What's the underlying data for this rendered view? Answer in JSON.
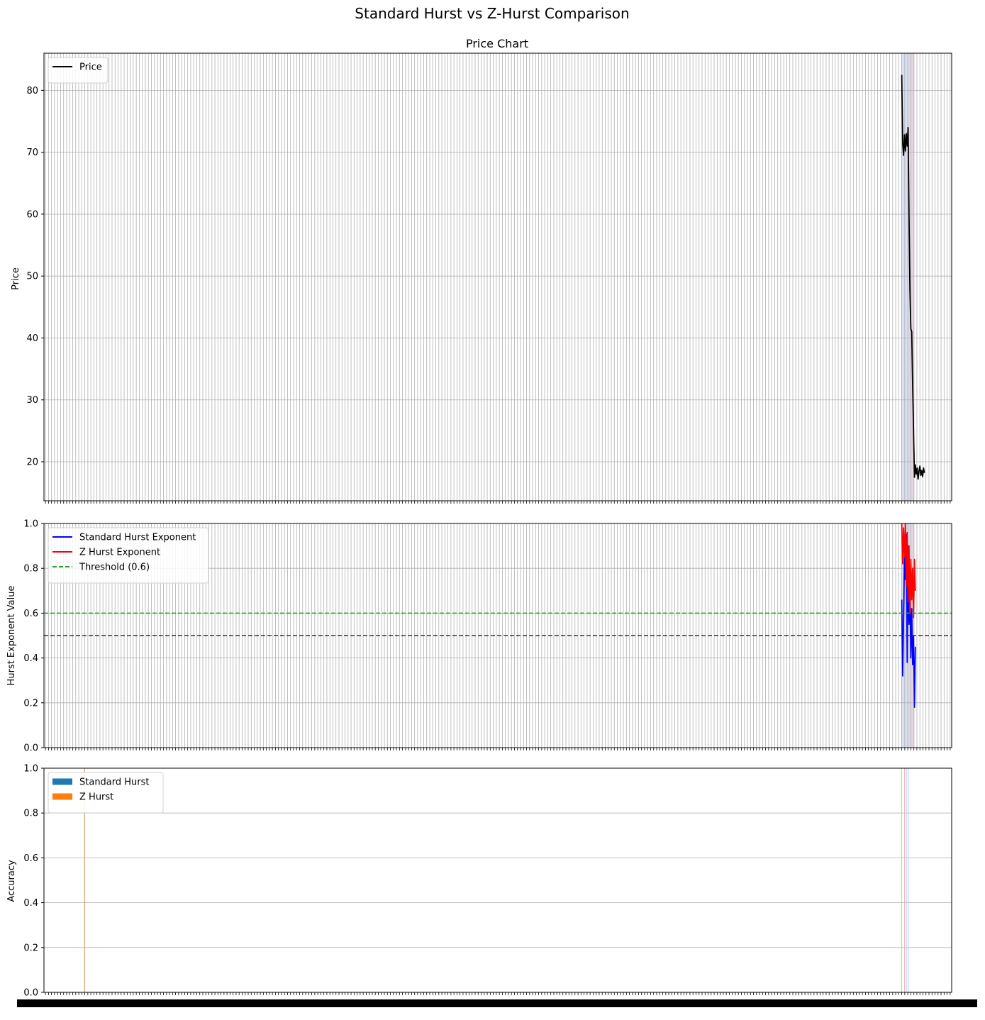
{
  "figure": {
    "title": "Standard Hurst vs Z-Hurst Comparison"
  },
  "chart_data": [
    {
      "type": "line",
      "title": "Price Chart",
      "xlabel": "",
      "ylabel": "Price",
      "ylim": [
        13.7,
        86.0
      ],
      "yticks": [
        20,
        30,
        40,
        50,
        60,
        70,
        80
      ],
      "grid": true,
      "legend": {
        "placement": "top-left",
        "entries": [
          "Price"
        ]
      },
      "series": [
        {
          "name": "Price",
          "color": "#000000",
          "x": [
            0.945,
            0.946,
            0.947,
            0.948,
            0.949,
            0.95,
            0.951,
            0.952,
            0.953,
            0.954,
            0.955,
            0.956,
            0.957,
            0.958,
            0.959,
            0.96,
            0.961,
            0.962,
            0.963,
            0.964,
            0.965,
            0.966,
            0.967,
            0.968,
            0.969,
            0.97
          ],
          "values": [
            82.5,
            71.5,
            69.5,
            72.8,
            70.2,
            73.0,
            71.0,
            74.0,
            60.0,
            48.0,
            41.5,
            41.0,
            32.5,
            25.0,
            17.5,
            19.5,
            18.0,
            19.0,
            17.2,
            18.5,
            19.3,
            17.8,
            18.6,
            17.6,
            19.0,
            18.2
          ]
        }
      ]
    },
    {
      "type": "line",
      "title": "",
      "xlabel": "",
      "ylabel": "Hurst Exponent Value",
      "ylim": [
        0.0,
        1.0
      ],
      "yticks": [
        0.0,
        0.2,
        0.4,
        0.6,
        0.8,
        1.0
      ],
      "grid": true,
      "legend": {
        "placement": "top-left",
        "entries": [
          "Standard Hurst Exponent",
          "Z Hurst Exponent",
          "Threshold (0.6)"
        ]
      },
      "series": [
        {
          "name": "Standard Hurst Exponent",
          "color": "#0000ff",
          "x": [
            0.945,
            0.946,
            0.947,
            0.948,
            0.949,
            0.95,
            0.951,
            0.952,
            0.953,
            0.954,
            0.955,
            0.956,
            0.957,
            0.958,
            0.959,
            0.96
          ],
          "values": [
            0.66,
            0.32,
            0.57,
            0.88,
            0.75,
            0.95,
            0.38,
            0.9,
            0.55,
            0.72,
            0.4,
            0.62,
            0.37,
            0.5,
            0.18,
            0.45
          ]
        },
        {
          "name": "Z Hurst Exponent",
          "color": "#ff0000",
          "x": [
            0.945,
            0.946,
            0.947,
            0.948,
            0.949,
            0.95,
            0.951,
            0.952,
            0.953,
            0.954,
            0.955,
            0.956,
            0.957,
            0.958,
            0.959,
            0.96
          ],
          "values": [
            1.0,
            0.82,
            0.98,
            0.85,
            1.0,
            0.72,
            0.96,
            0.65,
            0.9,
            0.6,
            0.84,
            0.66,
            0.8,
            0.58,
            0.84,
            0.7
          ]
        },
        {
          "name": "Threshold (0.6)",
          "color": "#2ca02c",
          "dashed": true,
          "constant": 0.6
        },
        {
          "name": "",
          "color": "#333333",
          "dashed": true,
          "constant": 0.5
        }
      ]
    },
    {
      "type": "bar",
      "title": "",
      "xlabel": "",
      "ylabel": "Accuracy",
      "ylim": [
        0.0,
        1.0
      ],
      "yticks": [
        0.0,
        0.2,
        0.4,
        0.6,
        0.8,
        1.0
      ],
      "grid": true,
      "legend": {
        "placement": "top-left",
        "entries": [
          "Standard Hurst",
          "Z Hurst"
        ]
      },
      "series": [
        {
          "name": "Standard Hurst",
          "color": "#1f77b4",
          "values": []
        },
        {
          "name": "Z Hurst",
          "color": "#ff7f0e",
          "values": []
        }
      ]
    }
  ]
}
